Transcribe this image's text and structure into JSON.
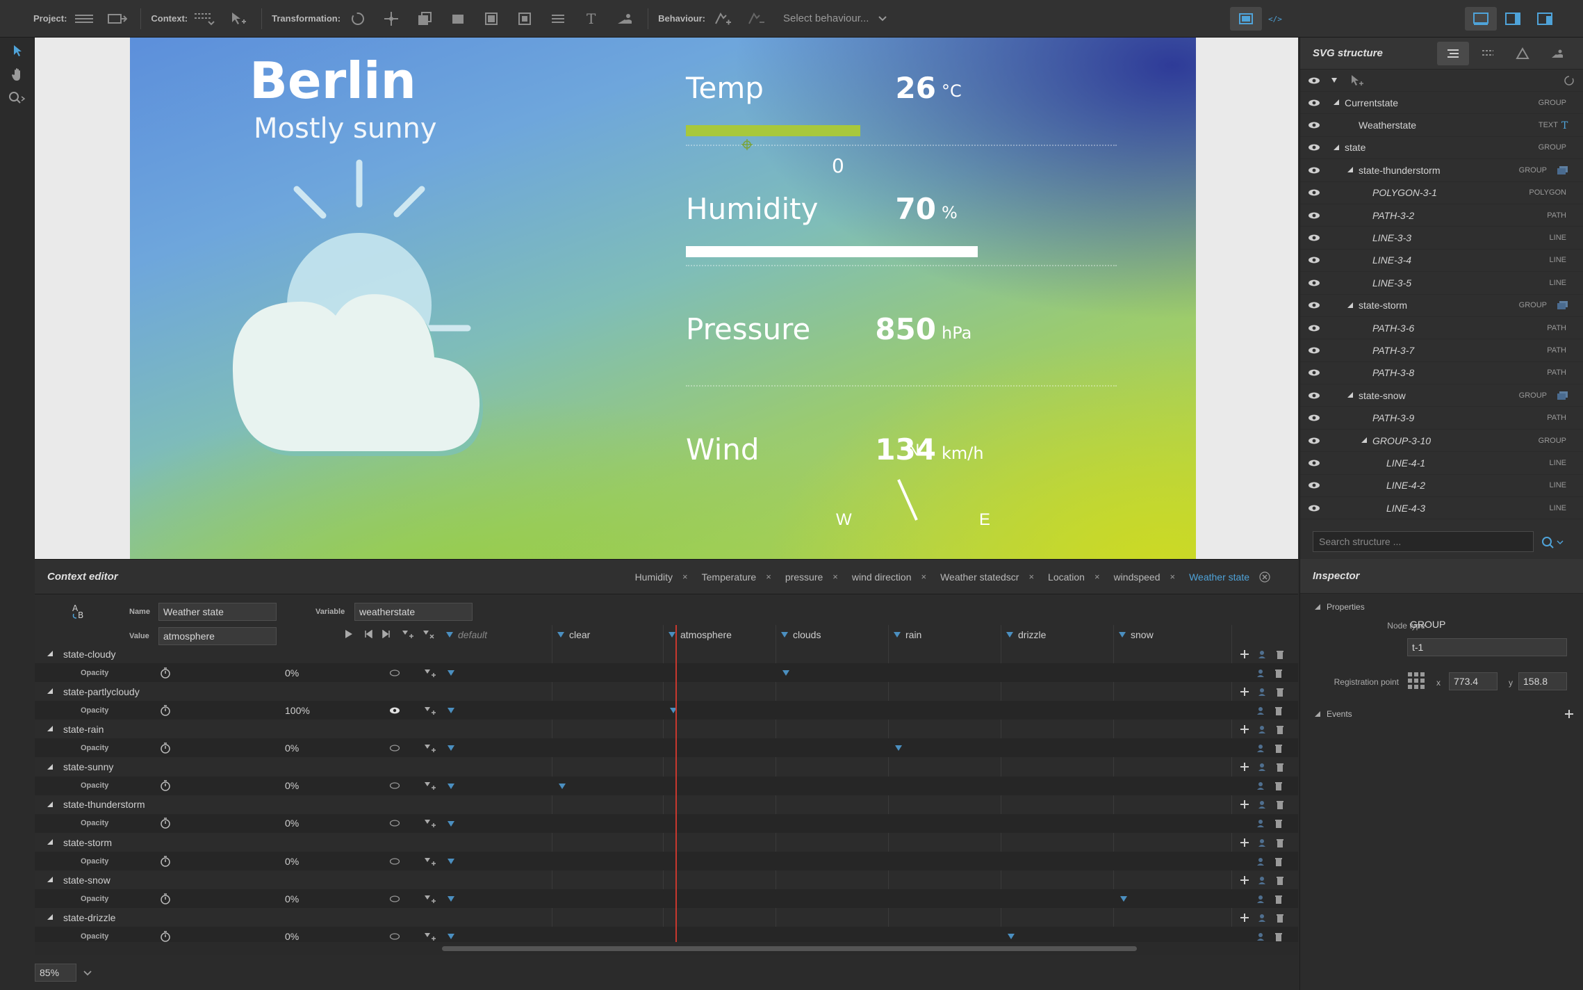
{
  "toolbar": {
    "project_label": "Project:",
    "context_label": "Context:",
    "transformation_label": "Transformation:",
    "behaviour_label": "Behaviour:",
    "behaviour_select": "Select behaviour..."
  },
  "weather": {
    "city": "Berlin",
    "condition": "Mostly sunny",
    "temp": {
      "label": "Temp",
      "value": "26",
      "unit": "°C",
      "tick": "0",
      "fill": 0.45
    },
    "humidity": {
      "label": "Humidity",
      "value": "70",
      "unit": "%",
      "fill": 0.7
    },
    "pressure": {
      "label": "Pressure",
      "value": "850",
      "unit": "hPa"
    },
    "wind": {
      "label": "Wind",
      "value": "134",
      "unit": "km/h",
      "n": "N",
      "w": "W",
      "e": "E"
    }
  },
  "structure": {
    "title": "SVG structure",
    "search_placeholder": "Search structure ...",
    "rows": [
      {
        "name": "Currentstate",
        "type": "GROUP",
        "depth": 0,
        "toggle": true,
        "italic": false
      },
      {
        "name": "Weatherstate",
        "type": "TEXT",
        "depth": 1,
        "toggle": false,
        "italic": false
      },
      {
        "name": "state",
        "type": "GROUP",
        "depth": 0,
        "toggle": true,
        "italic": false
      },
      {
        "name": "state-thunderstorm",
        "type": "GROUP",
        "depth": 1,
        "toggle": true,
        "italic": false
      },
      {
        "name": "POLYGON-3-1",
        "type": "POLYGON",
        "depth": 2,
        "toggle": false,
        "italic": true
      },
      {
        "name": "PATH-3-2",
        "type": "PATH",
        "depth": 2,
        "toggle": false,
        "italic": true
      },
      {
        "name": "LINE-3-3",
        "type": "LINE",
        "depth": 2,
        "toggle": false,
        "italic": true
      },
      {
        "name": "LINE-3-4",
        "type": "LINE",
        "depth": 2,
        "toggle": false,
        "italic": true
      },
      {
        "name": "LINE-3-5",
        "type": "LINE",
        "depth": 2,
        "toggle": false,
        "italic": true
      },
      {
        "name": "state-storm",
        "type": "GROUP",
        "depth": 1,
        "toggle": true,
        "italic": false
      },
      {
        "name": "PATH-3-6",
        "type": "PATH",
        "depth": 2,
        "toggle": false,
        "italic": true
      },
      {
        "name": "PATH-3-7",
        "type": "PATH",
        "depth": 2,
        "toggle": false,
        "italic": true
      },
      {
        "name": "PATH-3-8",
        "type": "PATH",
        "depth": 2,
        "toggle": false,
        "italic": true
      },
      {
        "name": "state-snow",
        "type": "GROUP",
        "depth": 1,
        "toggle": true,
        "italic": false
      },
      {
        "name": "PATH-3-9",
        "type": "PATH",
        "depth": 2,
        "toggle": false,
        "italic": true
      },
      {
        "name": "GROUP-3-10",
        "type": "GROUP",
        "depth": 2,
        "toggle": true,
        "italic": true
      },
      {
        "name": "LINE-4-1",
        "type": "LINE",
        "depth": 3,
        "toggle": false,
        "italic": true
      },
      {
        "name": "LINE-4-2",
        "type": "LINE",
        "depth": 3,
        "toggle": false,
        "italic": true
      },
      {
        "name": "LINE-4-3",
        "type": "LINE",
        "depth": 3,
        "toggle": false,
        "italic": true
      }
    ]
  },
  "context": {
    "title": "Context editor",
    "tabs": [
      "Humidity",
      "Temperature",
      "pressure",
      "wind direction",
      "Weather statedscr",
      "Location",
      "windspeed",
      "Weather state"
    ],
    "active_tab": "Weather state",
    "name_label": "Name",
    "name_value": "Weather state",
    "variable_label": "Variable",
    "variable_value": "weatherstate",
    "value_label": "Value",
    "value_value": "atmosphere",
    "columns": [
      "default",
      "clear",
      "atmosphere",
      "clouds",
      "rain",
      "drizzle",
      "snow"
    ],
    "opacity_label": "Opacity",
    "states": [
      {
        "name": "state-cloudy",
        "opacity": "0%",
        "visible": false,
        "key": "clouds"
      },
      {
        "name": "state-partlycloudy",
        "opacity": "100%",
        "visible": true,
        "key": "atmosphere"
      },
      {
        "name": "state-rain",
        "opacity": "0%",
        "visible": false,
        "key": "rain"
      },
      {
        "name": "state-sunny",
        "opacity": "0%",
        "visible": false,
        "key": "clear"
      },
      {
        "name": "state-thunderstorm",
        "opacity": "0%",
        "visible": false,
        "key": ""
      },
      {
        "name": "state-storm",
        "opacity": "0%",
        "visible": false,
        "key": ""
      },
      {
        "name": "state-snow",
        "opacity": "0%",
        "visible": false,
        "key": "snow"
      },
      {
        "name": "state-drizzle",
        "opacity": "0%",
        "visible": false,
        "key": "drizzle"
      }
    ]
  },
  "inspector": {
    "title": "Inspector",
    "properties_label": "Properties",
    "node_type_label": "Node type",
    "node_type_value": "GROUP",
    "id_label": "ID",
    "id_value": "t-1",
    "reg_label": "Registration point",
    "x_label": "x",
    "x_value": "773.4",
    "y_label": "y",
    "y_value": "158.8",
    "events_label": "Events"
  },
  "zoom": "85%",
  "colors": {
    "accent": "#4fa3d9",
    "playhead": "#c8382e",
    "temp_bar": "#a8c83c"
  }
}
